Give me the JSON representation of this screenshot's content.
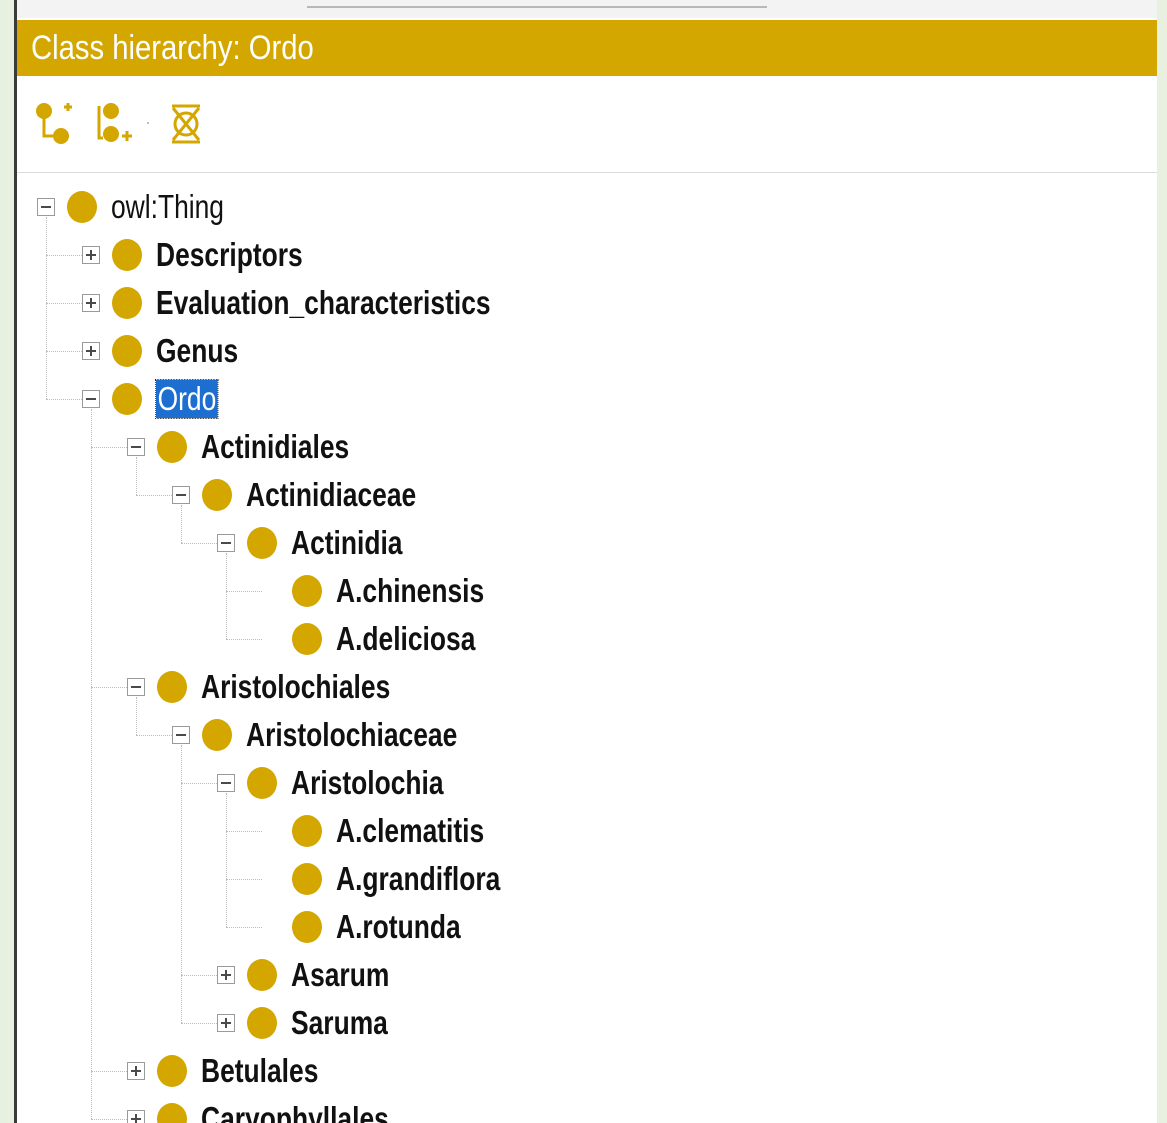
{
  "window": {
    "title": "Class hierarchy: Ordo"
  },
  "toolbar": {
    "buttons": [
      {
        "name": "add-subclass",
        "icon": "add-subclass-icon"
      },
      {
        "name": "add-sibling",
        "icon": "add-sibling-icon"
      },
      {
        "name": "delete-class",
        "icon": "delete-class-icon"
      }
    ]
  },
  "colors": {
    "accent": "#d3a700",
    "selection": "#1c6fd1",
    "background": "#e8f1df"
  },
  "tree": {
    "nodes": [
      {
        "label": "owl:Thing",
        "depth": 0,
        "toggle": "minus",
        "style": "normal"
      },
      {
        "label": "Descriptors",
        "depth": 1,
        "toggle": "plus",
        "style": "bold"
      },
      {
        "label": "Evaluation_characteristics",
        "depth": 1,
        "toggle": "plus",
        "style": "bold"
      },
      {
        "label": "Genus",
        "depth": 1,
        "toggle": "plus",
        "style": "bold"
      },
      {
        "label": "Ordo",
        "depth": 1,
        "toggle": "minus",
        "style": "selected"
      },
      {
        "label": "Actinidiales",
        "depth": 2,
        "toggle": "minus",
        "style": "bold"
      },
      {
        "label": "Actinidiaceae",
        "depth": 3,
        "toggle": "minus",
        "style": "bold"
      },
      {
        "label": "Actinidia",
        "depth": 4,
        "toggle": "minus",
        "style": "bold"
      },
      {
        "label": "A.chinensis",
        "depth": 5,
        "toggle": "none",
        "style": "bold"
      },
      {
        "label": "A.deliciosa",
        "depth": 5,
        "toggle": "none",
        "style": "bold"
      },
      {
        "label": "Aristolochiales",
        "depth": 2,
        "toggle": "minus",
        "style": "bold"
      },
      {
        "label": "Aristolochiaceae",
        "depth": 3,
        "toggle": "minus",
        "style": "bold"
      },
      {
        "label": "Aristolochia",
        "depth": 4,
        "toggle": "minus",
        "style": "bold"
      },
      {
        "label": "A.clematitis",
        "depth": 5,
        "toggle": "none",
        "style": "bold"
      },
      {
        "label": "A.grandiflora",
        "depth": 5,
        "toggle": "none",
        "style": "bold"
      },
      {
        "label": "A.rotunda",
        "depth": 5,
        "toggle": "none",
        "style": "bold"
      },
      {
        "label": "Asarum",
        "depth": 4,
        "toggle": "plus",
        "style": "bold"
      },
      {
        "label": "Saruma",
        "depth": 4,
        "toggle": "plus",
        "style": "bold"
      },
      {
        "label": "Betulales",
        "depth": 2,
        "toggle": "plus",
        "style": "bold"
      },
      {
        "label": "Caryophyllales",
        "depth": 2,
        "toggle": "plus",
        "style": "bold"
      }
    ]
  }
}
